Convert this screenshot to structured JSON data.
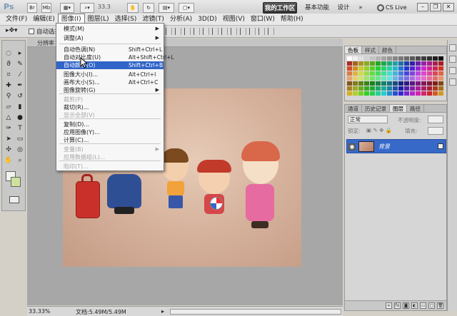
{
  "app": {
    "logo": "Ps",
    "zoom_value": "33.3",
    "toolbar_btn_bridge": "Br",
    "toolbar_btn_minibridge": "Mb"
  },
  "workspace": {
    "active": "我的工作区",
    "basic": "基本功能",
    "design": "设计",
    "cs_live": "CS Live"
  },
  "menubar": {
    "items": [
      "文件(F)",
      "编辑(E)",
      "图像(I)",
      "图层(L)",
      "选择(S)",
      "滤镜(T)",
      "分析(A)",
      "3D(D)",
      "视图(V)",
      "窗口(W)",
      "帮助(H)"
    ]
  },
  "options": {
    "auto_select": "自动选择"
  },
  "document": {
    "tab_label": "分辨率"
  },
  "status": {
    "zoom": "33.33%",
    "doc_size": "文档:5.49M/5.49M"
  },
  "image_menu": {
    "items": [
      {
        "label": "模式(M)",
        "shortcut": "",
        "submenu": true,
        "disabled": false
      },
      {
        "label": "调整(A)",
        "shortcut": "",
        "submenu": true,
        "disabled": false
      },
      {
        "label": "自动色调(N)",
        "shortcut": "Shift+Ctrl+L",
        "submenu": false,
        "disabled": false
      },
      {
        "label": "自动对比度(U)",
        "shortcut": "Alt+Shift+Ctrl+L",
        "submenu": false,
        "disabled": false
      },
      {
        "label": "自动颜色(O)",
        "shortcut": "Shift+Ctrl+B",
        "submenu": false,
        "disabled": false,
        "highlighted": true
      },
      {
        "label": "图像大小(I)...",
        "shortcut": "Alt+Ctrl+I",
        "submenu": false,
        "disabled": false
      },
      {
        "label": "画布大小(S)...",
        "shortcut": "Alt+Ctrl+C",
        "submenu": false,
        "disabled": false
      },
      {
        "label": "图像旋转(G)",
        "shortcut": "",
        "submenu": true,
        "disabled": false
      },
      {
        "label": "裁剪(P)",
        "shortcut": "",
        "submenu": false,
        "disabled": true
      },
      {
        "label": "裁切(R)...",
        "shortcut": "",
        "submenu": false,
        "disabled": false
      },
      {
        "label": "显示全部(V)",
        "shortcut": "",
        "submenu": false,
        "disabled": true
      },
      {
        "label": "复制(D)...",
        "shortcut": "",
        "submenu": false,
        "disabled": false
      },
      {
        "label": "应用图像(Y)...",
        "shortcut": "",
        "submenu": false,
        "disabled": false
      },
      {
        "label": "计算(C)...",
        "shortcut": "",
        "submenu": false,
        "disabled": false
      },
      {
        "label": "变量(B)",
        "shortcut": "",
        "submenu": true,
        "disabled": true
      },
      {
        "label": "应用数据组(L)...",
        "shortcut": "",
        "submenu": false,
        "disabled": true
      },
      {
        "label": "陷印(T)...",
        "shortcut": "",
        "submenu": false,
        "disabled": true
      }
    ]
  },
  "swatch_panel": {
    "tabs": [
      "色板",
      "样式",
      "颜色"
    ]
  },
  "layers_panel": {
    "tabs": [
      "通道",
      "历史记录",
      "图层",
      "路径"
    ],
    "blend_mode": "正常",
    "opacity_label": "不透明度:",
    "lock_label": "锁定:",
    "fill_label": "填充:",
    "layer_name": "背景"
  },
  "colors": {
    "foreground": "#f3f3ef",
    "background": "#cde29b",
    "menu_highlight": "#3064c8",
    "layer_selected": "#3769c9"
  }
}
